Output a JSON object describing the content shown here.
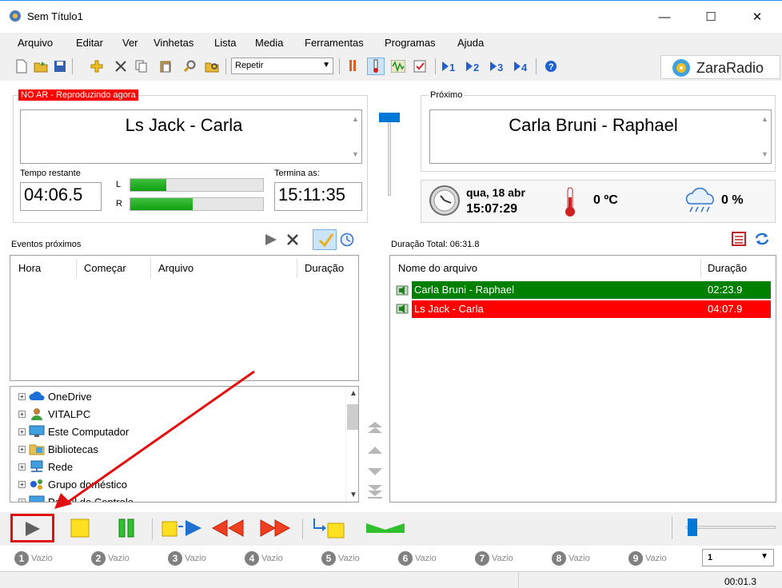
{
  "window": {
    "title": "Sem Título1",
    "minimize": "—",
    "maximize": "☐",
    "close": "✕"
  },
  "menu": [
    "Arquivo",
    "Editar",
    "Ver",
    "Vinhetas",
    "Lista",
    "Media",
    "Ferramentas",
    "Programas",
    "Ajuda"
  ],
  "toolbar": {
    "repeat_value": "Repetir",
    "logo_text": "ZaraRadio"
  },
  "on_air": {
    "badge": "NO AR - Reproduzindo agora",
    "now_playing": "Ls Jack - Carla",
    "remaining_label": "Tempo restante",
    "remaining": "04:06.5",
    "ends_label": "Termina as:",
    "ends": "15:11:35",
    "meter_left_label": "L",
    "meter_right_label": "R",
    "meter_left_level": 0.27,
    "meter_right_level": 0.47
  },
  "next": {
    "label": "Próximo",
    "title": "Carla Bruni - Raphael"
  },
  "info": {
    "date": "qua, 18 abr",
    "time": "15:07:29",
    "temperature": "0 ºC",
    "rain": "0 %"
  },
  "events": {
    "label": "Eventos próximos",
    "columns": [
      "Hora",
      "Começar",
      "Arquivo",
      "Duração"
    ]
  },
  "playlist": {
    "total_label": "Duração Total: 06:31.8",
    "columns": [
      "Nome do arquivo",
      "Duração"
    ],
    "rows": [
      {
        "name": "Carla Bruni - Raphael",
        "duration": "02:23.9",
        "color": "#008000"
      },
      {
        "name": "Ls Jack - Carla",
        "duration": "04:07.9",
        "color": "#ff0000"
      }
    ]
  },
  "tree": [
    "OneDrive",
    "VITALPC",
    "Este Computador",
    "Bibliotecas",
    "Rede",
    "Grupo doméstico",
    "Painel de Controle"
  ],
  "slots": [
    {
      "num": "1",
      "label": "Vazio"
    },
    {
      "num": "2",
      "label": "Vazio"
    },
    {
      "num": "3",
      "label": "Vazio"
    },
    {
      "num": "4",
      "label": "Vazio"
    },
    {
      "num": "5",
      "label": "Vazio"
    },
    {
      "num": "6",
      "label": "Vazio"
    },
    {
      "num": "7",
      "label": "Vazio"
    },
    {
      "num": "8",
      "label": "Vazio"
    },
    {
      "num": "9",
      "label": "Vazio"
    }
  ],
  "slot_select": "1",
  "status": {
    "elapsed": "00:01.3"
  },
  "colors": {
    "accent_red": "#ff0000",
    "accent_green": "#008000"
  }
}
